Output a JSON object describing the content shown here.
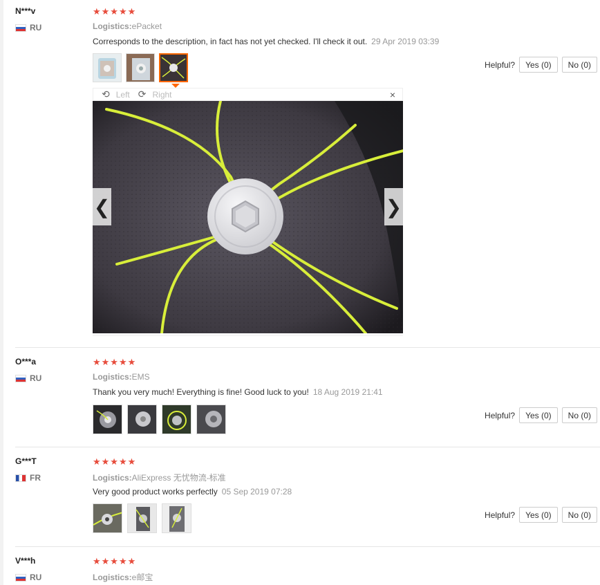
{
  "reviews": [
    {
      "user": "N***v",
      "country": "RU",
      "stars": "★★★★★",
      "logistics_label": "Logistics:",
      "logistics_value": "ePacket",
      "comment": "Corresponds to the description, in fact has not yet checked. I'll check it out.",
      "date": "29 Apr 2019 03:39",
      "helpful": "Helpful?",
      "yes": "Yes (0)",
      "no": "No (0)"
    },
    {
      "user": "O***a",
      "country": "RU",
      "stars": "★★★★★",
      "logistics_label": "Logistics:",
      "logistics_value": "EMS",
      "comment": "Thank you very much! Everything is fine! Good luck to you!",
      "date": "18 Aug 2019 21:41",
      "helpful": "Helpful?",
      "yes": "Yes (0)",
      "no": "No (0)"
    },
    {
      "user": "G***T",
      "country": "FR",
      "stars": "★★★★★",
      "logistics_label": "Logistics:",
      "logistics_value": "AliExpress 无忧物流-标准",
      "comment": "Very good product works perfectly",
      "date": "05 Sep 2019 07:28",
      "helpful": "Helpful?",
      "yes": "Yes (0)",
      "no": "No (0)"
    },
    {
      "user": "V***h",
      "country": "RU",
      "stars": "★★★★★",
      "logistics_label": "Logistics:",
      "logistics_value": "e邮宝"
    }
  ],
  "viewer": {
    "left_label": "Left",
    "right_label": "Right",
    "close": "×",
    "prev": "❮",
    "next": "❯"
  },
  "colors": {
    "star": "#e74c3c",
    "active_thumb": "#ff6600",
    "trimmer_line": "#d8ee3a"
  }
}
